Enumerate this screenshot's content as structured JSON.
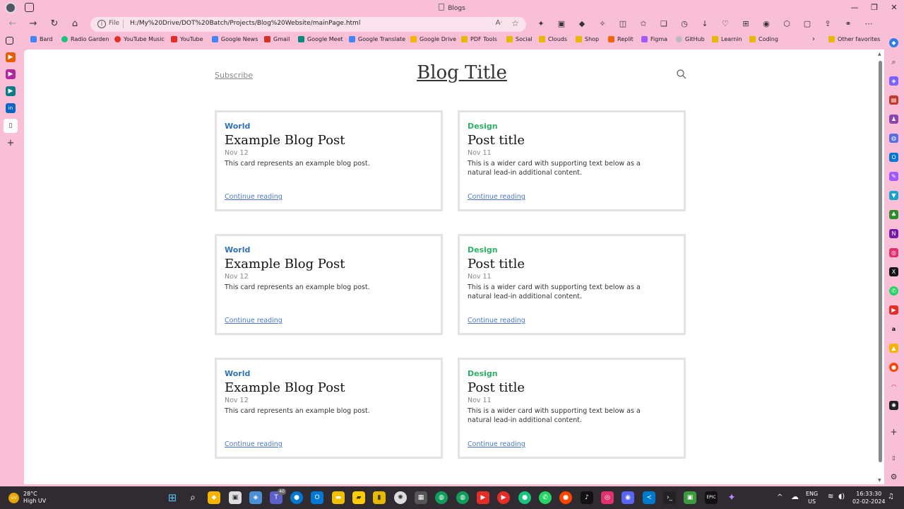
{
  "window": {
    "title": "Blogs",
    "controls": [
      "—",
      "❐",
      "✕"
    ]
  },
  "address": {
    "scheme_label": "File",
    "url": "H:/My%20Drive/DOT%20Batch/Projects/Blog%20Website/mainPage.html"
  },
  "bookmarks": [
    {
      "label": "Bard",
      "icon": "sparkle-icon",
      "color": "#4285f4"
    },
    {
      "label": "Radio Garden",
      "icon": "dot-icon",
      "color": "#19c37d"
    },
    {
      "label": "YouTube Music",
      "icon": "youtube-music-icon",
      "color": "#e52d27"
    },
    {
      "label": "YouTube",
      "icon": "youtube-icon",
      "color": "#e52d27"
    },
    {
      "label": "Google News",
      "icon": "google-news-icon",
      "color": "#4285f4"
    },
    {
      "label": "Gmail",
      "icon": "gmail-icon",
      "color": "#d93025"
    },
    {
      "label": "Google Meet",
      "icon": "google-meet-icon",
      "color": "#00897b"
    },
    {
      "label": "Google Translate",
      "icon": "google-translate-icon",
      "color": "#4285f4"
    },
    {
      "label": "Google Drive",
      "icon": "google-drive-icon",
      "color": "#f4b400"
    },
    {
      "label": "PDF Tools",
      "icon": "folder-icon",
      "color": "#e6b800"
    },
    {
      "label": "Social",
      "icon": "folder-icon",
      "color": "#e6b800"
    },
    {
      "label": "Clouds",
      "icon": "folder-icon",
      "color": "#e6b800"
    },
    {
      "label": "Shop",
      "icon": "folder-icon",
      "color": "#e6b800"
    },
    {
      "label": "Replit",
      "icon": "replit-icon",
      "color": "#f26207"
    },
    {
      "label": "Figma",
      "icon": "figma-icon",
      "color": "#a259ff"
    },
    {
      "label": "GitHub",
      "icon": "github-icon",
      "color": "#bbbbbb"
    },
    {
      "label": "Learnin",
      "icon": "folder-icon",
      "color": "#e6b800"
    },
    {
      "label": "Coding",
      "icon": "folder-icon",
      "color": "#e6b800"
    }
  ],
  "bookmarks_more": "›",
  "other_favorites": "Other favorites",
  "page": {
    "subscribe": "Subscribe",
    "blog_title": "Blog Title",
    "continue": "Continue reading",
    "cards": [
      {
        "category": "World",
        "title": "Example Blog Post",
        "date": "Nov 12",
        "text": "This card represents an example blog post."
      },
      {
        "category": "Design",
        "title": "Post title",
        "date": "Nov 11",
        "text": "This is a wider card with supporting text below as a natural lead-in additional content."
      },
      {
        "category": "World",
        "title": "Example Blog Post",
        "date": "Nov 12",
        "text": "This card represents an example blog post."
      },
      {
        "category": "Design",
        "title": "Post title",
        "date": "Nov 11",
        "text": "This is a wider card with supporting text below as a natural lead-in additional content."
      },
      {
        "category": "World",
        "title": "Example Blog Post",
        "date": "Nov 12",
        "text": "This card represents an example blog post."
      },
      {
        "category": "Design",
        "title": "Post title",
        "date": "Nov 11",
        "text": "This is a wider card with supporting text below as a natural lead-in additional content."
      }
    ]
  },
  "taskbar": {
    "temperature": "28°C",
    "weather_desc": "High UV",
    "badge": "40",
    "lang1": "ENG",
    "lang2": "US",
    "time": "16:33:30",
    "date": "02-02-2024"
  }
}
